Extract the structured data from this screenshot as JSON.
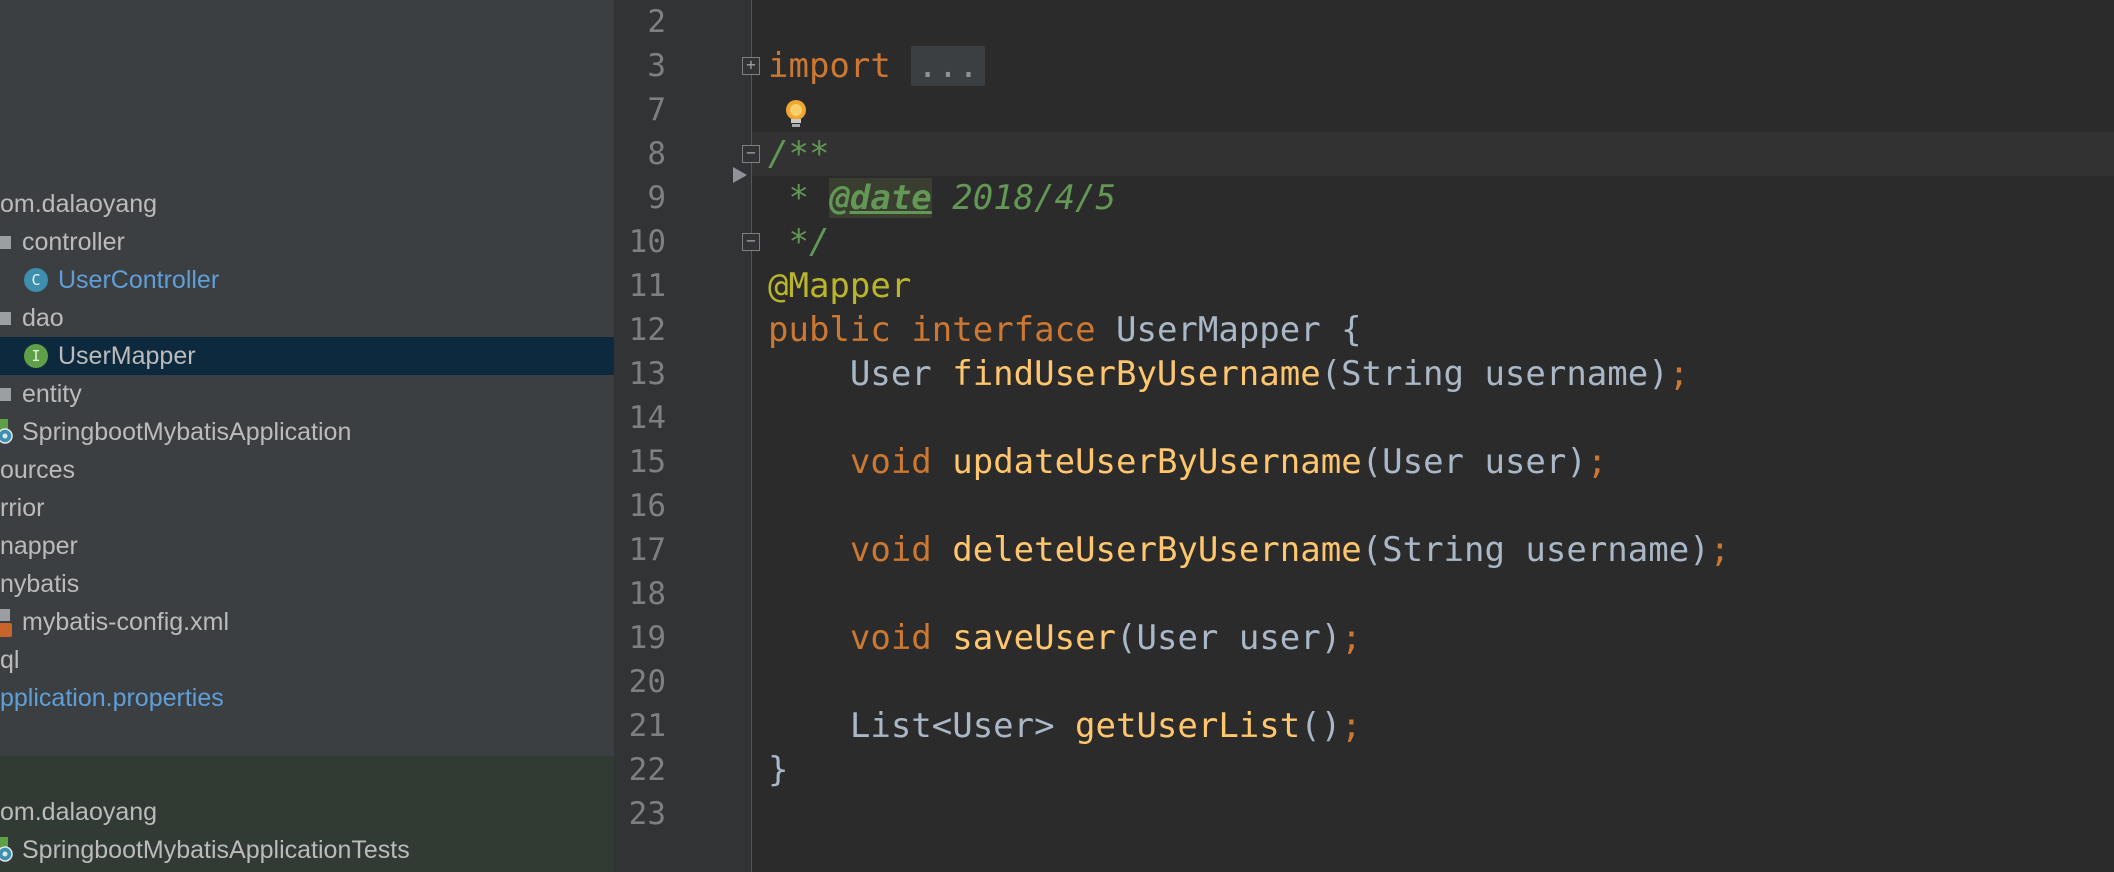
{
  "colors": {
    "tree_background": "#3c3f41",
    "tree_selection": "#0d293e",
    "tree_test_background": "#313b33",
    "editor_background": "#2b2b2b",
    "gutter_background": "#313335",
    "keyword": "#cc7832",
    "annotation": "#bbb529",
    "method": "#ffc66d",
    "doc_comment": "#629755",
    "plain_text": "#a9b7c6"
  },
  "project_tree": {
    "items": [
      {
        "label": "om.dalaoyang",
        "icon": "package-icon",
        "style": "plain"
      },
      {
        "label": "controller",
        "icon": "folder-icon",
        "style": "plain"
      },
      {
        "label": "UserController",
        "icon": "class-icon",
        "style": "link"
      },
      {
        "label": "dao",
        "icon": "folder-icon",
        "style": "plain"
      },
      {
        "label": "UserMapper",
        "icon": "interface-icon",
        "style": "plain",
        "selected": true
      },
      {
        "label": "entity",
        "icon": "folder-icon",
        "style": "plain"
      },
      {
        "label": "SpringbootMybatisApplication",
        "icon": "spring-boot-app-icon",
        "style": "plain"
      },
      {
        "label": "ources",
        "icon": "folder-icon",
        "style": "plain"
      },
      {
        "label": "rrior",
        "icon": "folder-icon",
        "style": "plain"
      },
      {
        "label": "napper",
        "icon": "folder-icon",
        "style": "plain"
      },
      {
        "label": "nybatis",
        "icon": "folder-icon",
        "style": "plain"
      },
      {
        "label": "mybatis-config.xml",
        "icon": "xml-file-icon",
        "style": "plain"
      },
      {
        "label": "ql",
        "icon": "folder-icon",
        "style": "plain"
      },
      {
        "label": "pplication.properties",
        "icon": "properties-file-icon",
        "style": "link"
      },
      {
        "label": "om.dalaoyang",
        "icon": "package-icon",
        "style": "plain"
      },
      {
        "label": "SpringbootMybatisApplicationTests",
        "icon": "spring-boot-test-icon",
        "style": "plain"
      }
    ]
  },
  "editor": {
    "line_numbers": [
      "2",
      "3",
      "7",
      "8",
      "9",
      "10",
      "11",
      "12",
      "13",
      "14",
      "15",
      "16",
      "17",
      "18",
      "19",
      "20",
      "21",
      "22",
      "23"
    ],
    "code": {
      "import_kw": "import",
      "import_folded": "...",
      "doc_open": "/**",
      "doc_star": " * ",
      "doc_tag": "@date",
      "doc_value": " 2018/4/5",
      "doc_close": " */",
      "annotation": "@Mapper",
      "kw_public": "public",
      "kw_interface": "interface",
      "interface_name": " UserMapper {",
      "m1_return": "    User ",
      "m1_name": "findUserByUsername",
      "m1_params": "(String username)",
      "m2_return": "void",
      "m2_name": "updateUserByUsername",
      "m2_params": "(User user)",
      "m3_return": "void",
      "m3_name": "deleteUserByUsername",
      "m3_params": "(String username)",
      "m4_return": "void",
      "m4_name": "saveUser",
      "m4_params": "(User user)",
      "m5_return": "    List<User> ",
      "m5_name": "getUserList",
      "m5_params": "()",
      "semicolon": ";",
      "closing_brace": "}"
    }
  }
}
